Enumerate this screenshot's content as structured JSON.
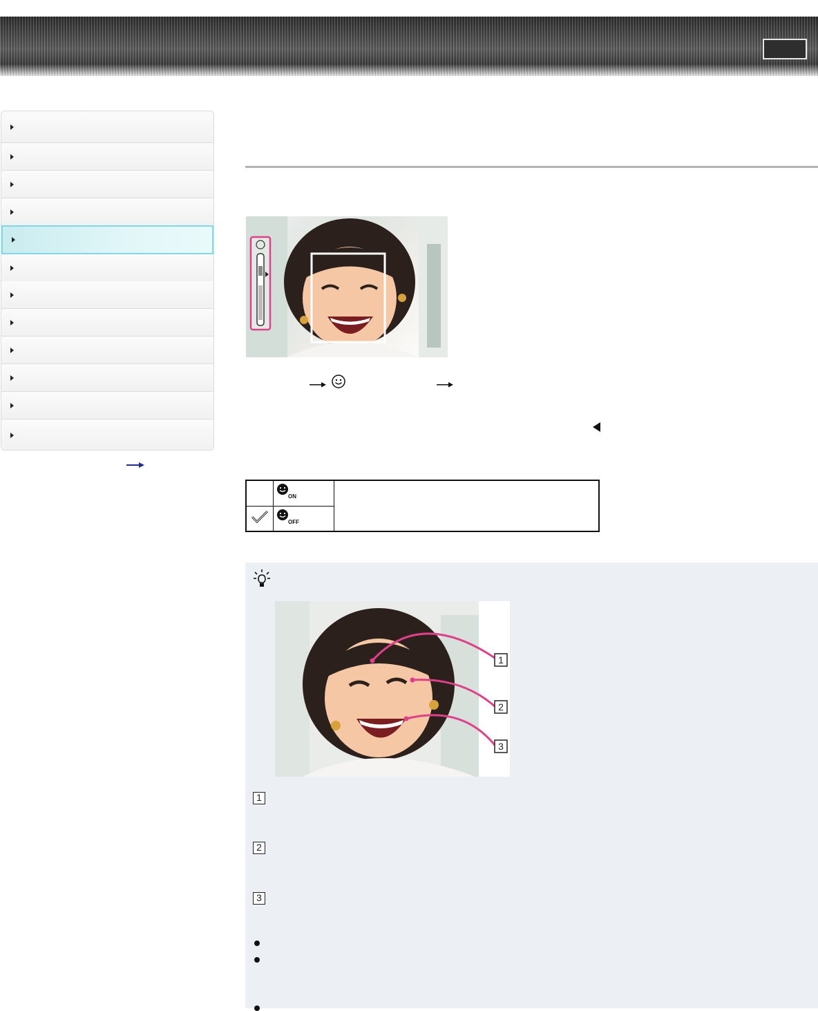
{
  "header": {
    "button_label": ""
  },
  "sidebar": {
    "items": [
      {
        "label": ""
      },
      {
        "label": ""
      },
      {
        "label": ""
      },
      {
        "label": ""
      },
      {
        "label": "",
        "active": true
      },
      {
        "label": ""
      },
      {
        "label": ""
      },
      {
        "label": ""
      },
      {
        "label": ""
      },
      {
        "label": ""
      },
      {
        "label": ""
      },
      {
        "label": ""
      }
    ]
  },
  "colors": {
    "accent_active": "#7fd9e6",
    "highlight_pink": "#e0408a",
    "hint_bg": "#eceff4"
  },
  "options_table": {
    "rows": [
      {
        "checked": false,
        "icon": "smile-on-icon",
        "icon_text": "ON"
      },
      {
        "checked": true,
        "icon": "smile-off-icon",
        "icon_text": "OFF"
      }
    ]
  },
  "diagram": {
    "callouts": [
      "1",
      "2",
      "3"
    ]
  },
  "hint": {
    "numbered_items": [
      "1",
      "2",
      "3"
    ]
  }
}
